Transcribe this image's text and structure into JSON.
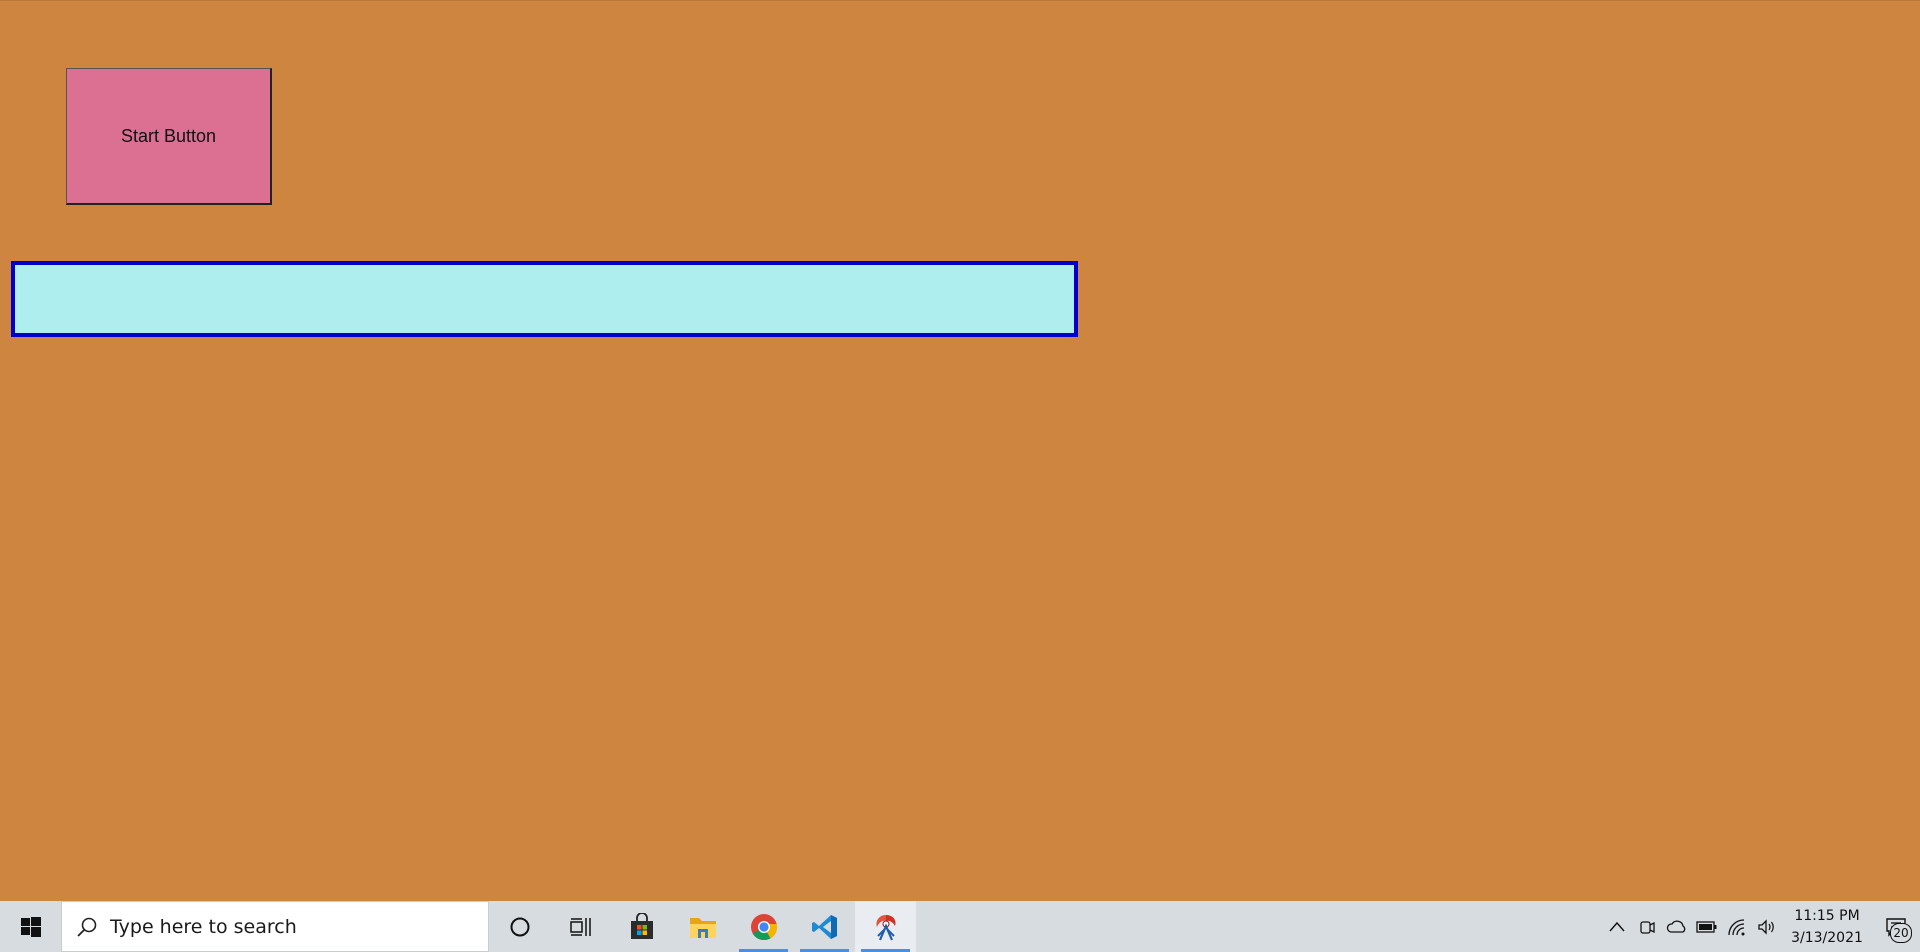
{
  "app": {
    "start_button_label": "Start Button",
    "input_value": "",
    "colors": {
      "background": "#CD853F",
      "button_bg": "#DB7093",
      "input_bg": "#AFEEEE",
      "input_border": "#0000CD"
    }
  },
  "taskbar": {
    "search_placeholder": "Type here to search",
    "pinned": [
      {
        "name": "cortana-icon"
      },
      {
        "name": "task-view-icon"
      },
      {
        "name": "microsoft-store-icon"
      },
      {
        "name": "file-explorer-icon"
      },
      {
        "name": "chrome-icon",
        "running": true
      },
      {
        "name": "vscode-icon",
        "running": true
      },
      {
        "name": "tk-app-icon",
        "running": true,
        "active": true
      }
    ],
    "tray_icons": [
      "chevron-up-icon",
      "meet-now-icon",
      "onedrive-icon",
      "battery-icon",
      "wifi-icon",
      "volume-icon"
    ],
    "time": "11:15 PM",
    "date": "3/13/2021",
    "notification_count": "20"
  }
}
